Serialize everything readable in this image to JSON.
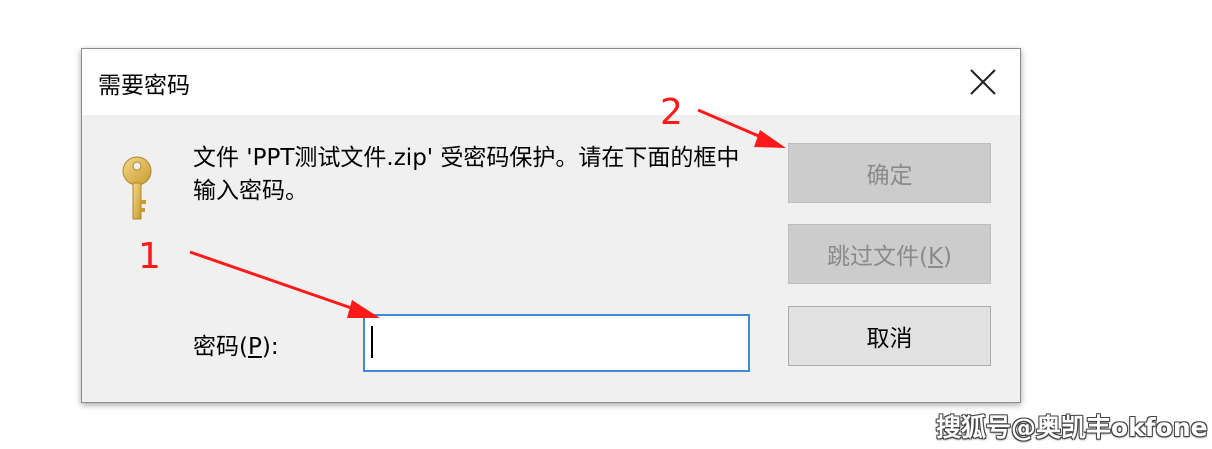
{
  "dialog": {
    "title": "需要密码",
    "message": "文件 'PPT测试文件.zip' 受密码保护。请在下面的框中输入密码。",
    "password_label_prefix": "密码(",
    "password_label_mnemonic": "P",
    "password_label_suffix": "):",
    "password_value": "",
    "buttons": {
      "ok": "确定",
      "skip_prefix": "跳过文件(",
      "skip_mnemonic": "K",
      "skip_suffix": ")",
      "cancel": "取消"
    }
  },
  "annotations": {
    "marker_1": "1",
    "marker_2": "2",
    "color": "#ff1a1a"
  },
  "watermark": "搜狐号@奥凯丰okfone",
  "icons": {
    "close": "close-icon",
    "key": "key-icon"
  }
}
